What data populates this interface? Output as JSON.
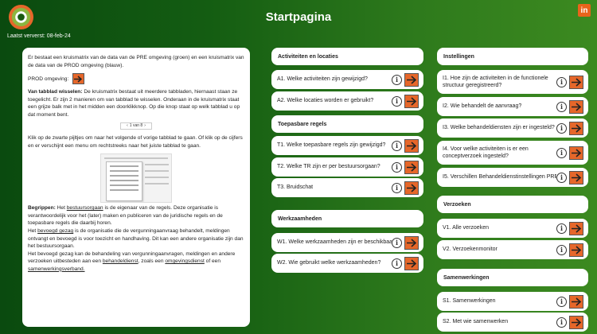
{
  "header": {
    "title": "Startpagina",
    "refresh_label": "Laatst ververst: 08-feb-24",
    "linkedin_label": "in"
  },
  "colors": {
    "accent": "#e6672a",
    "brand_green": "#2e7a1c"
  },
  "info": {
    "intro": "Er bestaat een kruismatrix van de data van de PRE omgeving (groen) en een kruismatrix van de data van de PROD omgeving (blauw).",
    "prod_label": "PROD omgeving:",
    "tabs_title": "Van tabblad wisselen:",
    "tabs_text": "De kruismatrix bestaat uit meerdere tabbladen, hiernaast staan ze toegelicht. Er zijn 2 manieren om van tabblad te wisselen. Onderaan in de kruismatrix staat een grijze balk met in het midden een doorklikknop. Op die knop staat op welk tabblad u op dat moment bent.",
    "pager_text": "1 van 8",
    "click_text": "Klik op de zwarte pijltjes om naar het volgende of vorige tabblad te gaan. Of klik op de cijfers en er verschijnt een menu om rechtstreeks naar het juiste tabblad te gaan.",
    "terms_title": "Begrippen:",
    "terms_1a": "Het",
    "terms_1_link": "bestuursorgaan",
    "terms_1b": "is de eigenaar van de regels. Deze organisatie is verantwoordelijk voor het (later) maken en publiceren van de juridische regels en de toepasbare regels die daarbij horen.",
    "terms_2a": "Het",
    "terms_2_link": "bevoegd gezag",
    "terms_2b": "is de organisatie die de vergunningaanvraag behandelt, meldingen ontvangt en bevoegd is voor toezicht en handhaving. Dit kan een andere organisatie zijn dan het bestuursorgaan.",
    "terms_3a": "Het bevoegd gezag kan de behandeling van vergunningaanvragen, meldingen en andere verzoeken uitbesteden aan een",
    "terms_3_link1": "behandeldienst",
    "terms_3b": ", zoals een",
    "terms_3_link2": "omgevingsdienst",
    "terms_3c": "of een",
    "terms_3_link3": "samenwerkingsverband."
  },
  "middle": {
    "activiteiten": {
      "header": "Activiteiten en locaties",
      "items": [
        "A1. Welke activiteiten zijn gewijzigd?",
        "A2. Welke locaties worden er gebruikt?"
      ]
    },
    "toepasbare": {
      "header": "Toepasbare regels",
      "items": [
        "T1. Welke toepasbare regels zijn gewijzigd?",
        "T2. Welke TR zijn er per bestuursorgaan?",
        "T3. Bruidschat"
      ]
    },
    "werkzaamheden": {
      "header": "Werkzaamheden",
      "items": [
        "W1. Welke werkzaamheden zijn er beschikbaar?",
        "W2. Wie gebruikt welke werkzaamheden?"
      ]
    }
  },
  "right": {
    "instellingen": {
      "header": "Instellingen",
      "items": [
        "I1. Hoe zijn de activiteiten in de functionele structuur geregistreerd?",
        "I2. Wie behandelt de aanvraag?",
        "I3. Welke behandeldiensten zijn er ingesteld?",
        "I4. Voor welke activiteiten is er een conceptverzoek ingesteld?",
        "I5. Verschillen Behandeldienstinstellingen PRE/PROD"
      ]
    },
    "verzoeken": {
      "header": "Verzoeken",
      "items": [
        "V1. Alle verzoeken",
        "V2. Verzoekenmonitor"
      ]
    },
    "samenwerkingen": {
      "header": "Samenwerkingen",
      "items": [
        "S1. Samenwerkingen",
        "S2. Met wie samenwerken"
      ]
    }
  }
}
